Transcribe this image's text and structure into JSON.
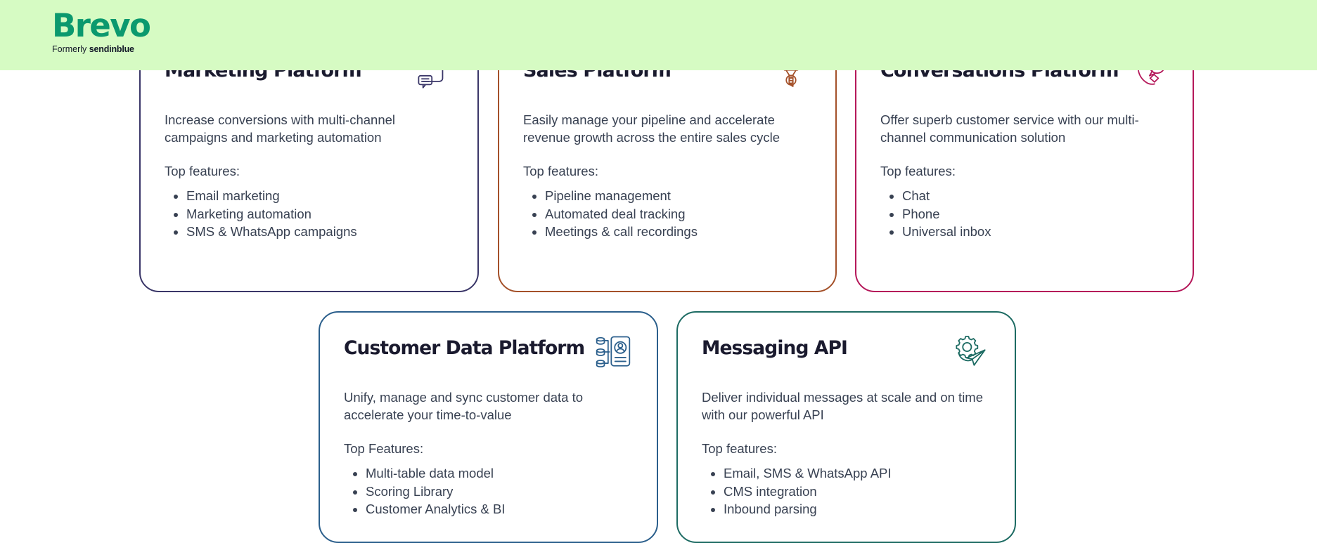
{
  "header": {
    "logo_text": "Brevo",
    "logo_formerly": "Formerly",
    "logo_former_brand": "sendinblue",
    "background_color": "#d6fbc3",
    "logo_color": "#0b996e"
  },
  "cards": [
    {
      "id": "marketing-platform",
      "title": "Marketing Platform",
      "description": "Increase conversions with multi-channel campaigns and marketing automation",
      "features_label": "Top features:",
      "features": [
        "Email marketing",
        "Marketing automation",
        "SMS & WhatsApp campaigns"
      ],
      "icon": "envelope-chat-icon",
      "accent_color": "#3a3668"
    },
    {
      "id": "sales-platform",
      "title": "Sales Platform",
      "description": "Easily manage your pipeline and accelerate revenue growth across the entire sales cycle",
      "features_label": "Top features:",
      "features": [
        "Pipeline management",
        "Automated deal tracking",
        "Meetings & call recordings"
      ],
      "icon": "sales-funnel-dollar-icon",
      "accent_color": "#a4512a"
    },
    {
      "id": "conversations-platform",
      "title": "Conversations Platform",
      "description": "Offer superb customer service with our multi-channel communication solution",
      "features_label": "Top features:",
      "features": [
        "Chat",
        "Phone",
        "Universal inbox"
      ],
      "icon": "phone-chat-bubble-icon",
      "accent_color": "#b5185a"
    },
    {
      "id": "customer-data-platform",
      "title": "Customer Data Platform",
      "description": "Unify, manage and sync customer data to accelerate your time-to-value",
      "features_label": "Top Features:",
      "features": [
        "Multi-table data model",
        "Scoring Library",
        "Customer Analytics & BI"
      ],
      "icon": "database-person-card-icon",
      "accent_color": "#2b5f8c"
    },
    {
      "id": "messaging-api",
      "title": "Messaging API",
      "description": "Deliver individual messages at scale and on time with our powerful API",
      "features_label": "Top features:",
      "features": [
        "Email, SMS & WhatsApp API",
        "CMS integration",
        "Inbound parsing"
      ],
      "icon": "gear-paper-plane-icon",
      "accent_color": "#1d6b63"
    }
  ]
}
